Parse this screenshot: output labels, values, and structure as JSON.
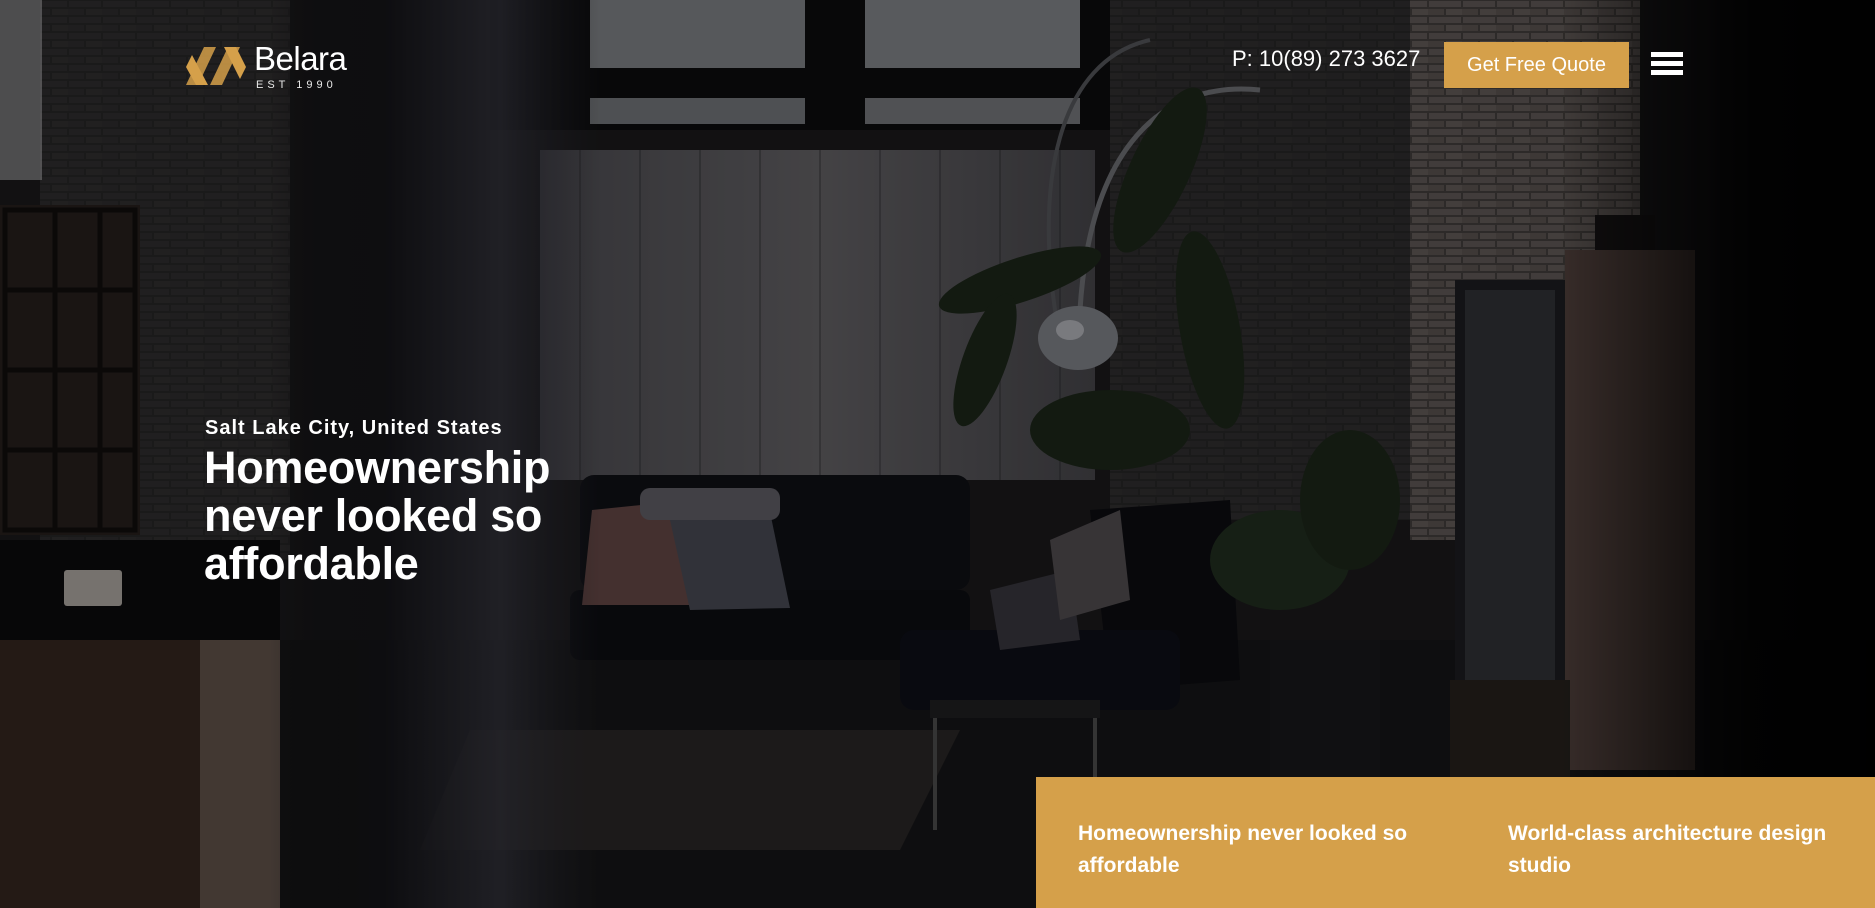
{
  "brand": {
    "name": "Belara",
    "established": "EST 1990",
    "accent_color": "#d5a04a"
  },
  "header": {
    "phone": "P: 10(89) 273 3627",
    "quote_button": "Get Free Quote",
    "menu_icon": "hamburger-menu-icon"
  },
  "hero": {
    "location": "Salt Lake City, United States",
    "headline": "Homeownership never looked so affordable"
  },
  "features": [
    {
      "title": "Homeownership never looked so affordable"
    },
    {
      "title": "World-class architecture design studio"
    }
  ]
}
